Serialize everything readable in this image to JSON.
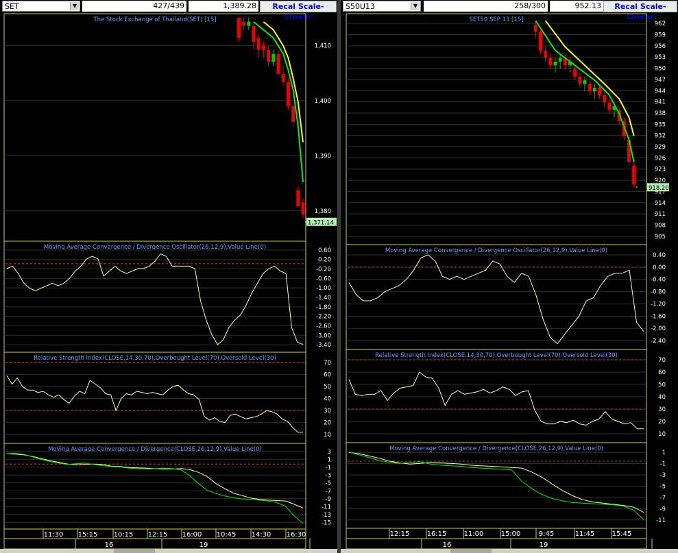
{
  "colors": {
    "up_candle": "#00cc00",
    "down_candle": "#ee0000",
    "ma_fast": "#00ee00",
    "ma_slow": "#ffff00",
    "grid": "#303030",
    "frame": "#cccc66",
    "title": "#7799ff",
    "ref_line": "#cc4444",
    "price_tag": "#b4f0b4"
  },
  "left": {
    "symbol": "SET",
    "counter": "427/439",
    "last_price": "1,389.28",
    "recal_label": "Recal Scale-Linear",
    "time_labels": [
      "11:30",
      "15:15",
      "10:15",
      "12:15",
      "16:00",
      "10:45",
      "14:30",
      "16:30"
    ],
    "date_labels": [
      "16",
      "19"
    ]
  },
  "right": {
    "symbol": "S50U13",
    "counter": "258/300",
    "last_price": "952.13",
    "recal_label": "Recal Scale-Linear",
    "time_labels": [
      "12:15",
      "16:15",
      "11:00",
      "15:00",
      "9:45",
      "11:45",
      "15:45"
    ],
    "date_labels": [
      "16",
      "19"
    ]
  },
  "chart_data": [
    {
      "type": "candlestick",
      "id": "left-price",
      "title": "The Stock Exchange of Thailand(SET) [15]",
      "y_ticks": [
        "1,410",
        "1,400",
        "1,390",
        "1,380"
      ],
      "ylim": [
        1367,
        1422
      ],
      "x_range": [
        0,
        60
      ],
      "last_value_label": "1,371.14",
      "last_value": 1371.14,
      "candles": [
        [
          47,
          1422,
          1422,
          1416,
          1417
        ],
        [
          48,
          1421,
          1422,
          1419,
          1420
        ],
        [
          49,
          1420,
          1422,
          1419,
          1421
        ],
        [
          50,
          1420,
          1421,
          1414,
          1416
        ],
        [
          51,
          1417,
          1418,
          1412,
          1414
        ],
        [
          52,
          1415,
          1416,
          1412,
          1414
        ],
        [
          53,
          1414,
          1415,
          1410,
          1411
        ],
        [
          54,
          1411,
          1414,
          1410,
          1413
        ],
        [
          55,
          1413,
          1414,
          1408,
          1408
        ],
        [
          56,
          1408,
          1410,
          1405,
          1406
        ],
        [
          57,
          1406,
          1407,
          1399,
          1400
        ],
        [
          58,
          1400,
          1401,
          1395,
          1396
        ],
        [
          59,
          1379,
          1380,
          1375,
          1375
        ],
        [
          60,
          1376,
          1377,
          1372,
          1373
        ]
      ],
      "ma_fast": [
        [
          50,
          1421
        ],
        [
          52,
          1419
        ],
        [
          54,
          1417
        ],
        [
          56,
          1413
        ],
        [
          57,
          1409
        ],
        [
          58,
          1404
        ],
        [
          59,
          1395
        ],
        [
          60,
          1381
        ]
      ],
      "ma_slow": [
        [
          52,
          1421
        ],
        [
          54,
          1419
        ],
        [
          56,
          1415
        ],
        [
          57,
          1412
        ],
        [
          58,
          1407
        ],
        [
          59,
          1401
        ],
        [
          60,
          1391
        ]
      ]
    },
    {
      "type": "line",
      "id": "left-macdosc",
      "title": "Moving Average Convergence / Divergence Oscillator(26,12,9),Value Line(0)",
      "y_ticks": [
        "0.60",
        "0.20",
        "-0.20",
        "-0.60",
        "-1.00",
        "-1.40",
        "-1.80",
        "-2.20",
        "-2.60",
        "-3.00",
        "-3.40"
      ],
      "ylim": [
        -3.5,
        0.75
      ],
      "ref_value": 0.0,
      "x_range": [
        0,
        60
      ],
      "values": [
        -0.2,
        -0.1,
        -0.4,
        -0.8,
        -1.0,
        -1.1,
        -1.0,
        -0.9,
        -0.8,
        -0.9,
        -0.8,
        -0.6,
        -0.3,
        -0.1,
        0.2,
        0.3,
        0.2,
        -0.5,
        -0.3,
        -0.1,
        -0.3,
        -0.4,
        -0.3,
        -0.2,
        -0.2,
        -0.1,
        0.1,
        0.4,
        0.3,
        -0.1,
        -0.1,
        -0.1,
        -0.1,
        -0.2,
        -1.5,
        -2.3,
        -2.9,
        -3.3,
        -3.1,
        -2.6,
        -2.3,
        -2.1,
        -1.7,
        -1.2,
        -0.8,
        -0.4,
        -0.2,
        -0.1,
        -0.3,
        -0.4,
        -2.6,
        -3.2,
        -3.3
      ]
    },
    {
      "type": "line",
      "id": "left-rsi",
      "title": "Relative Strength Index(CLOSE,14,30,70),Overbought Level(70),Oversold Level(30)",
      "y_ticks": [
        "70",
        "60",
        "50",
        "40",
        "30",
        "20",
        "10"
      ],
      "ylim": [
        5,
        75
      ],
      "ref_values": [
        70,
        30
      ],
      "x_range": [
        0,
        60
      ],
      "values": [
        59,
        52,
        57,
        50,
        47,
        47,
        45,
        46,
        43,
        41,
        43,
        39,
        36,
        42,
        46,
        44,
        55,
        52,
        49,
        44,
        43,
        30,
        40,
        44,
        43,
        46,
        45,
        44,
        45,
        44,
        43,
        47,
        50,
        51,
        47,
        44,
        43,
        39,
        25,
        22,
        24,
        21,
        20,
        26,
        27,
        25,
        23,
        24,
        25,
        27,
        30,
        29,
        27,
        23,
        21,
        16,
        12,
        12
      ]
    },
    {
      "type": "line",
      "id": "left-macd",
      "title": "Moving Average Convergence / Divergence(CLOSE,26,12,9),Value Line(0)",
      "y_ticks": [
        "3",
        "1",
        "-1",
        "-3",
        "-5",
        "-7",
        "-9",
        "-11",
        "-13",
        "-15"
      ],
      "ylim": [
        -15.5,
        3.5
      ],
      "ref_value": -0.5,
      "x_range": [
        0,
        60
      ],
      "series": [
        {
          "color": "#ffffaa",
          "values": [
            2,
            1.9,
            1.7,
            1.3,
            0.8,
            0.3,
            -0.1,
            -0.5,
            -0.7,
            -0.6,
            -0.5,
            -0.6,
            -1.0,
            -1.1,
            -1.3,
            -1.4,
            -1.5,
            -1.6,
            -1.7,
            -1.7,
            -1.6,
            -1.8,
            -2.5,
            -3.5,
            -5.2,
            -6.4,
            -7.5,
            -8.1,
            -8.7,
            -9.0,
            -9.2,
            -9.3,
            -9.4,
            -10.2,
            -11.1
          ]
        },
        {
          "color": "#00ee00",
          "values": [
            2,
            2.1,
            1.8,
            1.2,
            0.6,
            0.1,
            -0.3,
            -0.6,
            -0.4,
            -0.3,
            -0.6,
            -0.9,
            -1.1,
            -1.2,
            -1.5,
            -1.6,
            -1.7,
            -1.6,
            -1.5,
            -1.6,
            -1.9,
            -3.3,
            -5.2,
            -6.8,
            -7.6,
            -8.2,
            -8.6,
            -8.9,
            -9.0,
            -9.2,
            -9.4,
            -9.8,
            -10.7,
            -13.0,
            -14.8
          ]
        }
      ]
    },
    {
      "type": "candlestick",
      "id": "right-price",
      "title": "SET50 SEP 13   [15]",
      "y_ticks": [
        "962",
        "959",
        "956",
        "953",
        "950",
        "947",
        "944",
        "941",
        "938",
        "935",
        "932",
        "929",
        "926",
        "923",
        "920",
        "917",
        "914",
        "911",
        "908",
        "905"
      ],
      "ylim": [
        903.5,
        963.8
      ],
      "x_range": [
        0,
        60
      ],
      "last_value_label": "918.20",
      "last_value": 918.2,
      "candles": [
        [
          38,
          962,
          963,
          958,
          960
        ],
        [
          39,
          960,
          961,
          954,
          955
        ],
        [
          40,
          955,
          956,
          952,
          953
        ],
        [
          41,
          953,
          954,
          950,
          951
        ],
        [
          42,
          951,
          953,
          949,
          952
        ],
        [
          43,
          952,
          954,
          950,
          953
        ],
        [
          44,
          953,
          954,
          950,
          951
        ],
        [
          45,
          951,
          953,
          949,
          952
        ],
        [
          46,
          950,
          951,
          947,
          948
        ],
        [
          47,
          948,
          949,
          945,
          946
        ],
        [
          48,
          946,
          948,
          944,
          947
        ],
        [
          49,
          946,
          947,
          943,
          944
        ],
        [
          50,
          944,
          946,
          942,
          945
        ],
        [
          51,
          945,
          946,
          942,
          943
        ],
        [
          52,
          943,
          944,
          940,
          941
        ],
        [
          53,
          941,
          942,
          938,
          939
        ],
        [
          54,
          939,
          941,
          937,
          940
        ],
        [
          55,
          939,
          940,
          935,
          936
        ],
        [
          56,
          936,
          937,
          931,
          932
        ],
        [
          57,
          931,
          932,
          924,
          925
        ],
        [
          58,
          924,
          926,
          918,
          919
        ]
      ],
      "ma_fast": [
        [
          38,
          963
        ],
        [
          42,
          955
        ],
        [
          46,
          951
        ],
        [
          50,
          947
        ],
        [
          53,
          943
        ],
        [
          55,
          938
        ],
        [
          57,
          931
        ],
        [
          58,
          925
        ]
      ],
      "ma_slow": [
        [
          40,
          963
        ],
        [
          44,
          956
        ],
        [
          48,
          951
        ],
        [
          52,
          946
        ],
        [
          55,
          942
        ],
        [
          57,
          937
        ],
        [
          58,
          932
        ]
      ]
    },
    {
      "type": "line",
      "id": "right-macdosc",
      "title": "Moving Average Convergence / Divergence Oscillator(26,12,9),Value Line(0)",
      "y_ticks": [
        "0.40",
        "0.00",
        "-0.40",
        "-0.80",
        "-1.20",
        "-1.60",
        "-2.00",
        "-2.40"
      ],
      "ylim": [
        -2.6,
        0.6
      ],
      "ref_value": 0.0,
      "x_range": [
        0,
        60
      ],
      "values": [
        -0.5,
        -0.9,
        -1.1,
        -1.1,
        -1.0,
        -0.8,
        -0.7,
        -0.6,
        -0.4,
        -0.1,
        0.3,
        0.4,
        0.2,
        -0.3,
        -0.4,
        -0.3,
        -0.4,
        -0.3,
        -0.2,
        -0.1,
        0.2,
        0.1,
        -0.3,
        -0.5,
        -0.2,
        -0.3,
        -0.9,
        -1.7,
        -2.3,
        -2.5,
        -2.2,
        -1.9,
        -1.6,
        -1.1,
        -1.0,
        -0.6,
        -0.3,
        -0.2,
        -0.2,
        -0.1,
        -1.8,
        -2.1
      ]
    },
    {
      "type": "line",
      "id": "right-rsi",
      "title": "Relative Strength Index(CLOSE,14,30,70),Overbought Level(70),Oversold Level(30)",
      "y_ticks": [
        "70",
        "60",
        "50",
        "40",
        "30",
        "20",
        "10"
      ],
      "ylim": [
        5,
        75
      ],
      "ref_values": [
        70,
        30
      ],
      "x_range": [
        0,
        60
      ],
      "values": [
        54,
        42,
        41,
        42,
        42,
        45,
        37,
        43,
        47,
        48,
        49,
        60,
        56,
        55,
        47,
        33,
        42,
        45,
        42,
        43,
        44,
        46,
        43,
        45,
        48,
        46,
        41,
        44,
        45,
        29,
        20,
        18,
        18,
        20,
        19,
        21,
        18,
        17,
        20,
        22,
        28,
        22,
        20,
        18,
        19,
        14,
        14
      ]
    },
    {
      "type": "line",
      "id": "right-macd",
      "title": "Moving Average Convergence / Divergence(CLOSE,26,12,9),Value Line(0)",
      "y_ticks": [
        "1",
        "-1",
        "-3",
        "-5",
        "-7",
        "-9",
        "-11"
      ],
      "ylim": [
        -11.5,
        2.2
      ],
      "ref_value": -0.3,
      "x_range": [
        0,
        60
      ],
      "series": [
        {
          "color": "#ffffaa",
          "values": [
            1.2,
            1.0,
            0.6,
            0.2,
            -0.3,
            -0.6,
            -0.8,
            -0.7,
            -0.5,
            -0.6,
            -0.7,
            -0.8,
            -1.0,
            -1.1,
            -1.2,
            -1.3,
            -1.4,
            -1.5,
            -2.2,
            -3.1,
            -4.3,
            -5.4,
            -6.3,
            -7.0,
            -7.4,
            -7.6,
            -7.8,
            -8.0,
            -8.3,
            -9.2
          ]
        },
        {
          "color": "#00ee00",
          "values": [
            1.3,
            0.8,
            0.3,
            -0.2,
            -0.5,
            -0.7,
            -0.5,
            -0.4,
            -0.8,
            -1.0,
            -1.1,
            -1.2,
            -1.4,
            -1.5,
            -1.6,
            -1.7,
            -1.8,
            -3.8,
            -5.1,
            -6.1,
            -6.8,
            -7.2,
            -7.5,
            -7.6,
            -7.7,
            -7.8,
            -7.9,
            -8.1,
            -8.8,
            -10.5
          ]
        }
      ]
    }
  ]
}
